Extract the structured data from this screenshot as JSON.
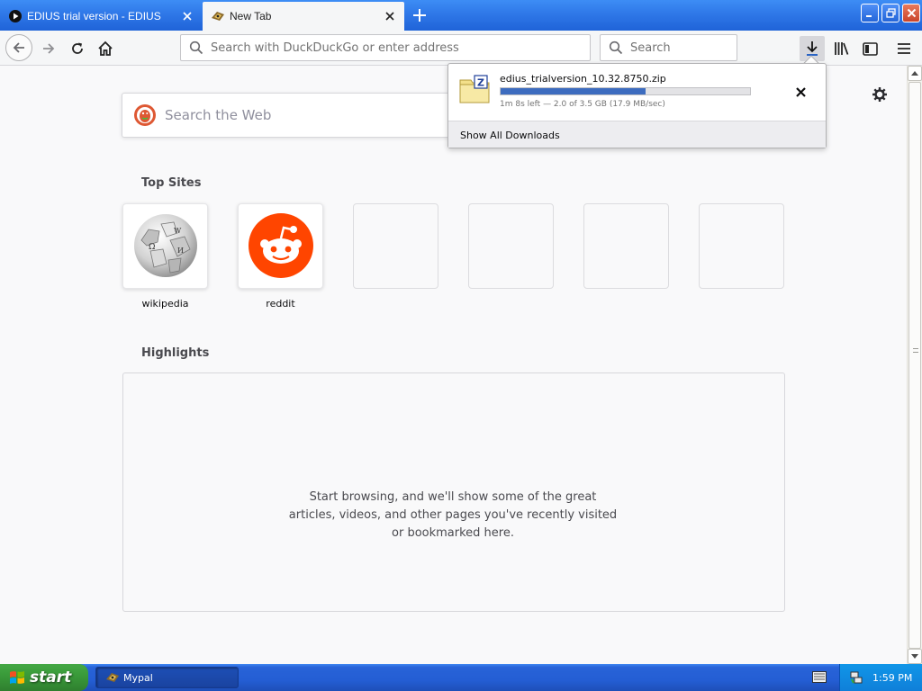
{
  "browser": {
    "tabs": [
      {
        "title": "EDIUS trial version - EDIUS",
        "active": false
      },
      {
        "title": "New Tab",
        "active": true
      }
    ],
    "url_placeholder": "Search with DuckDuckGo or enter address",
    "search_placeholder": "Search"
  },
  "newtab": {
    "web_search_placeholder": "Search the Web",
    "top_sites_title": "Top Sites",
    "top_sites": [
      {
        "label": "wikipedia",
        "icon": "wikipedia-globe-icon"
      },
      {
        "label": "reddit",
        "icon": "reddit-icon"
      },
      {
        "label": ""
      },
      {
        "label": ""
      },
      {
        "label": ""
      },
      {
        "label": ""
      }
    ],
    "highlights_title": "Highlights",
    "highlights_message": "Start browsing, and we'll show some of the great articles, videos, and other pages you've recently visited or bookmarked here."
  },
  "downloads": {
    "filename": "edius_trialversion_10.32.8750.zip",
    "progress": 0.58,
    "status": "1m 8s left — 2.0 of 3.5 GB (17.9 MB/sec)",
    "show_all_label": "Show All Downloads"
  },
  "taskbar": {
    "start_label": "start",
    "task_label": "Mypal",
    "clock": "1:59 PM"
  },
  "colors": {
    "titlebar": "#2f78e8",
    "progress_fill": "#3d6cbf",
    "reddit": "#ff4500",
    "start_green": "#3a9b3a"
  }
}
